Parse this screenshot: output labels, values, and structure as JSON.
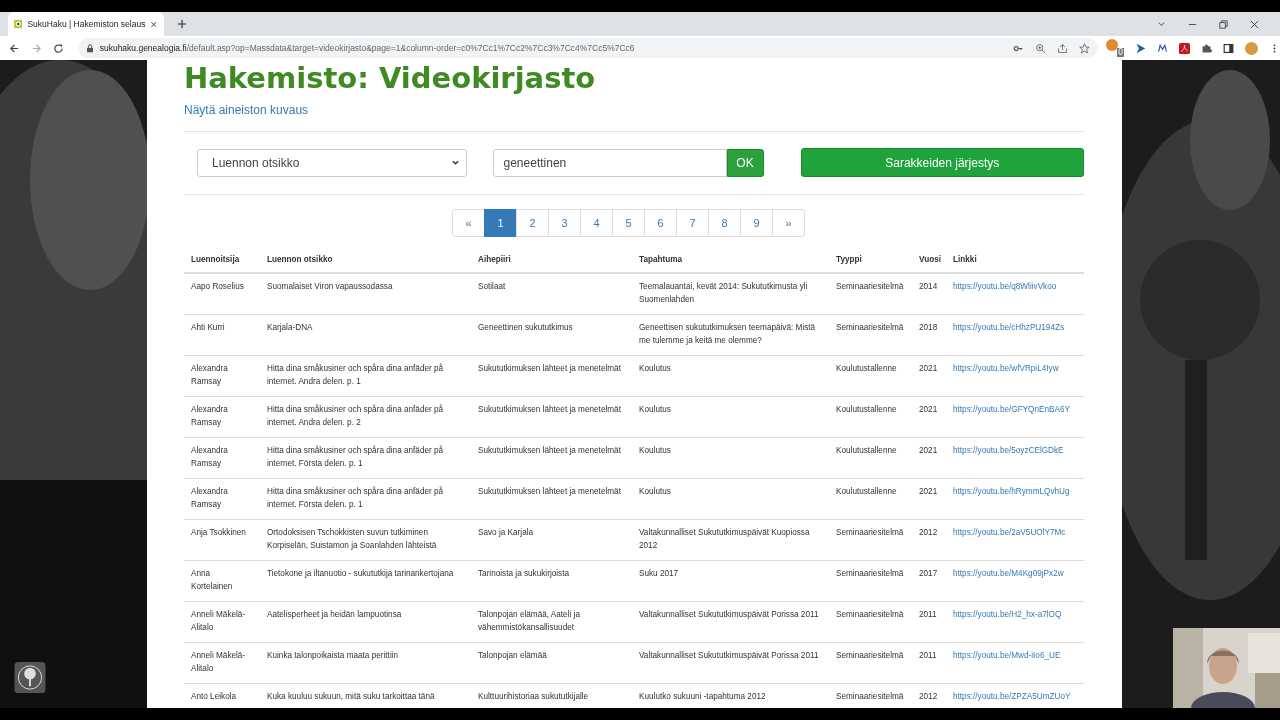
{
  "browser": {
    "tab_title": "SukuHaku | Hakemiston selaus",
    "url_host": "sukuhaku.genealogia.fi",
    "url_path": "/default.asp?op=Massdata&target=videokirjasto&page=1&column-order=c0%7Cc1%7Cc2%7Cc3%7Cc4%7Cc5%7Cc6",
    "extension_badge": "0"
  },
  "page": {
    "title": "Hakemisto: Videokirjasto",
    "description_link": "Näytä aineiston kuvaus",
    "filter": {
      "field_select": "Luennon otsikko",
      "search_value": "geneettinen",
      "ok_button": "OK",
      "order_button": "Sarakkeiden järjestys"
    },
    "pagination": [
      {
        "label": "«",
        "selected": false
      },
      {
        "label": "1",
        "selected": true
      },
      {
        "label": "2",
        "selected": false
      },
      {
        "label": "3",
        "selected": false
      },
      {
        "label": "4",
        "selected": false
      },
      {
        "label": "5",
        "selected": false
      },
      {
        "label": "6",
        "selected": false
      },
      {
        "label": "7",
        "selected": false
      },
      {
        "label": "8",
        "selected": false
      },
      {
        "label": "9",
        "selected": false
      },
      {
        "label": "»",
        "selected": false
      }
    ],
    "table": {
      "columns": [
        "Luennoitsija",
        "Luennon otsikko",
        "Aihepiiri",
        "Tapahtuma",
        "Tyyppi",
        "Vuosi",
        "Linkki"
      ],
      "rows": [
        [
          "Aapo Roselius",
          "Suomalaiset Viron vapaussodassa",
          "Sotilaat",
          "Teemalauantai, kevät 2014: Sukututkimusta yli Suomenlahden",
          "Seminaariesitelmä",
          "2014",
          "https://youtu.be/q8WliivVkoo"
        ],
        [
          "Ahti Kurri",
          "Karjala-DNA",
          "Geneettinen sukututkimus",
          "Geneettisen sukututkimuksen teemapäivä: Mistä me tulemme ja keitä me olemme?",
          "Seminaariesitelmä",
          "2018",
          "https://youtu.be/cHhzPU194Zs"
        ],
        [
          "Alexandra Ramsay",
          "Hitta dina småkusiner och spåra dina anfäder på internet. Andra delen. p. 1",
          "Sukututkimuksen lähteet ja menetelmät",
          "Koulutus",
          "Koulutustallenne",
          "2021",
          "https://youtu.be/wfVRpiL4Iyw"
        ],
        [
          "Alexandra Ramsay",
          "Hitta dina småkusiner och spåra dina anfäder på internet. Andra delen. p. 2",
          "Sukututkimuksen lähteet ja menetelmät",
          "Koulutus",
          "Koulutustallenne",
          "2021",
          "https://youtu.be/GFYQnEnBA6Y"
        ],
        [
          "Alexandra Ramsay",
          "Hitta dina småkusiner och spåra dina anfäder på internet. Första delen. p. 1",
          "Sukututkimuksen lähteet ja menetelmät",
          "Koulutus",
          "Koulutustallenne",
          "2021",
          "https://youtu.be/5oyzCElGDkE"
        ],
        [
          "Alexandra Ramsay",
          "Hitta dina småkusiner och spåra dina anfäder på internet. Första delen. p. 1",
          "Sukututkimuksen lähteet ja menetelmät",
          "Koulutus",
          "Koulutustallenne",
          "2021",
          "https://youtu.be/hRymmLQvhUg"
        ],
        [
          "Anja Tsokkinen",
          "Ortodoksisen Tschokkisten suvun tutkiminen Korpiselän, Suistamon ja Soanlahden lähteistä",
          "Savo ja Karjala",
          "Valtakunnalliset Sukututkimuspäivät Kuopiossa 2012",
          "Seminaariesitelmä",
          "2012",
          "https://youtu.be/2aV5UOlY7Mc"
        ],
        [
          "Anna Kortelainen",
          "Tietokone ja iltanuotio - sukututkija tarinankertojana",
          "Tarinoista ja sukukirjoista",
          "Suku 2017",
          "Seminaariesitelmä",
          "2017",
          "https://youtu.be/M4Kg09jPx2w"
        ],
        [
          "Anneli Mäkelä-Alitalo",
          "Aatelisperheet ja heidän lampuotinsa",
          "Talonpojan elämää, Aateli ja vähemmistökansallisuudet",
          "Valtakunnalliset Sukututkimuspäivät Porissa 2011",
          "Seminaariesitelmä",
          "2011",
          "https://youtu.be/H2_hx-a7lOQ"
        ],
        [
          "Anneli Mäkelä-Alitalo",
          "Kuinka talonpoikaista maata perittiin",
          "Talonpojan elämää",
          "Valtakunnalliset Sukututkimuspäivät Porissa 2011",
          "Seminaariesitelmä",
          "2011",
          "https://youtu.be/Mwd-iIo6_UE"
        ],
        [
          "Anto Leikola",
          "Kuka kuuluu sukuun, mitä suku tarkoittaa tänä",
          "Kulttuurihistoriaa sukututkijalle",
          "Kuulutko sukuuni -tapahtuma 2012",
          "Seminaariesitelmä",
          "2012",
          "https://youtu.be/ZPZA5UmZUoY"
        ]
      ]
    }
  }
}
